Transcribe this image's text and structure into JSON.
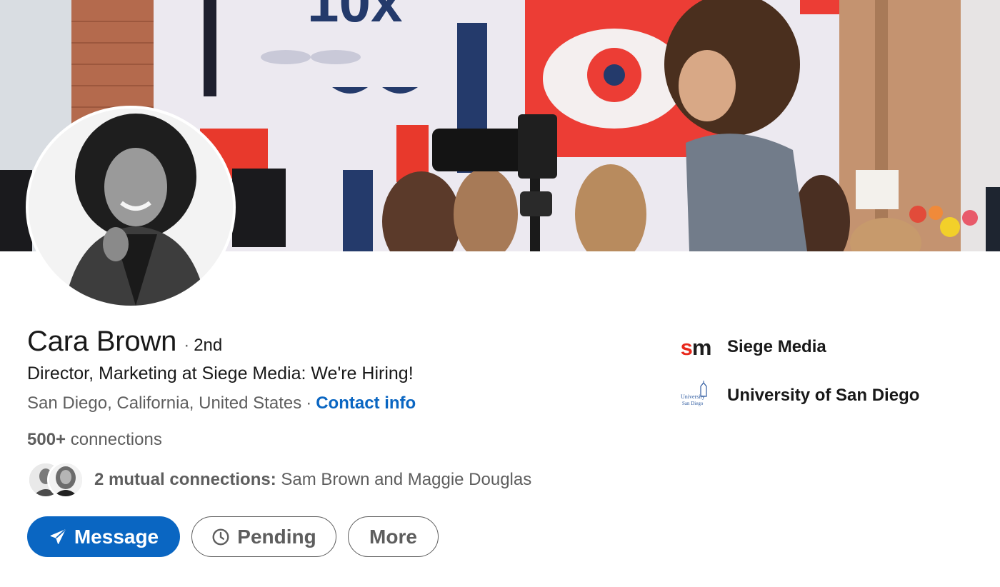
{
  "profile": {
    "name": "Cara Brown",
    "degree": "2nd",
    "headline": "Director, Marketing at Siege Media: We're Hiring!",
    "location": "San Diego, California, United States",
    "contact_link": "Contact info"
  },
  "connections": {
    "count": "500+",
    "label": "connections"
  },
  "mutual": {
    "label": "2 mutual connections:",
    "names": "Sam Brown and Maggie Douglas"
  },
  "actions": {
    "message_label": "Message",
    "pending_label": "Pending",
    "more_label": "More"
  },
  "sidebar": {
    "company": "Siege Media",
    "company_logo_text": "sm",
    "school": "University of San Diego",
    "school_logo_text": "University of San Diego"
  },
  "colors": {
    "primary": "#0a66c2",
    "brand_red": "#e8291c"
  }
}
